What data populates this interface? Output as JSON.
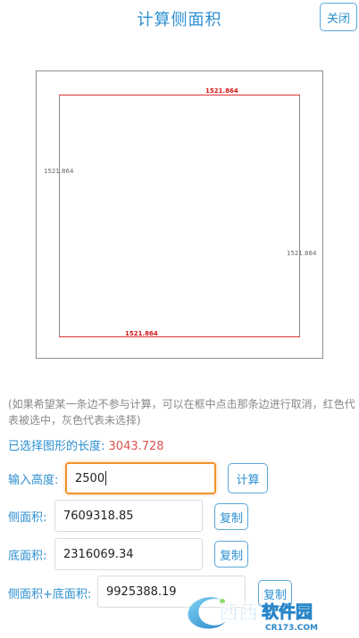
{
  "header": {
    "title": "计算侧面积",
    "close_label": "关闭"
  },
  "canvas": {
    "edges": [
      {
        "position": "top",
        "length": "1521.864",
        "selected": true
      },
      {
        "position": "left",
        "length": "1521.864",
        "selected": false
      },
      {
        "position": "right",
        "length": "1521.864",
        "selected": false
      },
      {
        "position": "bottom",
        "length": "1521.864",
        "selected": true
      }
    ]
  },
  "hint": "(如果希望某一条边不参与计算，可以在框中点击那条边进行取消，红色代表被选中，灰色代表未选择)",
  "selected_length": {
    "label": "已选择图形的长度:",
    "value": "3043.728"
  },
  "height_row": {
    "label": "输入高度:",
    "value": "2500",
    "button": "计算"
  },
  "side_area_row": {
    "label": "侧面积:",
    "value": "7609318.85",
    "button": "复制"
  },
  "base_area_row": {
    "label": "底面积:",
    "value": "2316069.34",
    "button": "复制"
  },
  "total_row": {
    "label": "侧面积+底面积:",
    "value": "9925388.19",
    "button": "复制"
  },
  "watermark": {
    "brand": "西西",
    "site": "CR173.COM",
    "suffix": "软件园"
  },
  "colors": {
    "accent": "#2d8fd0",
    "selected_edge": "#e03030",
    "unselected_edge": "#888888",
    "focus": "#f0932b",
    "value_highlight": "#e05050"
  }
}
